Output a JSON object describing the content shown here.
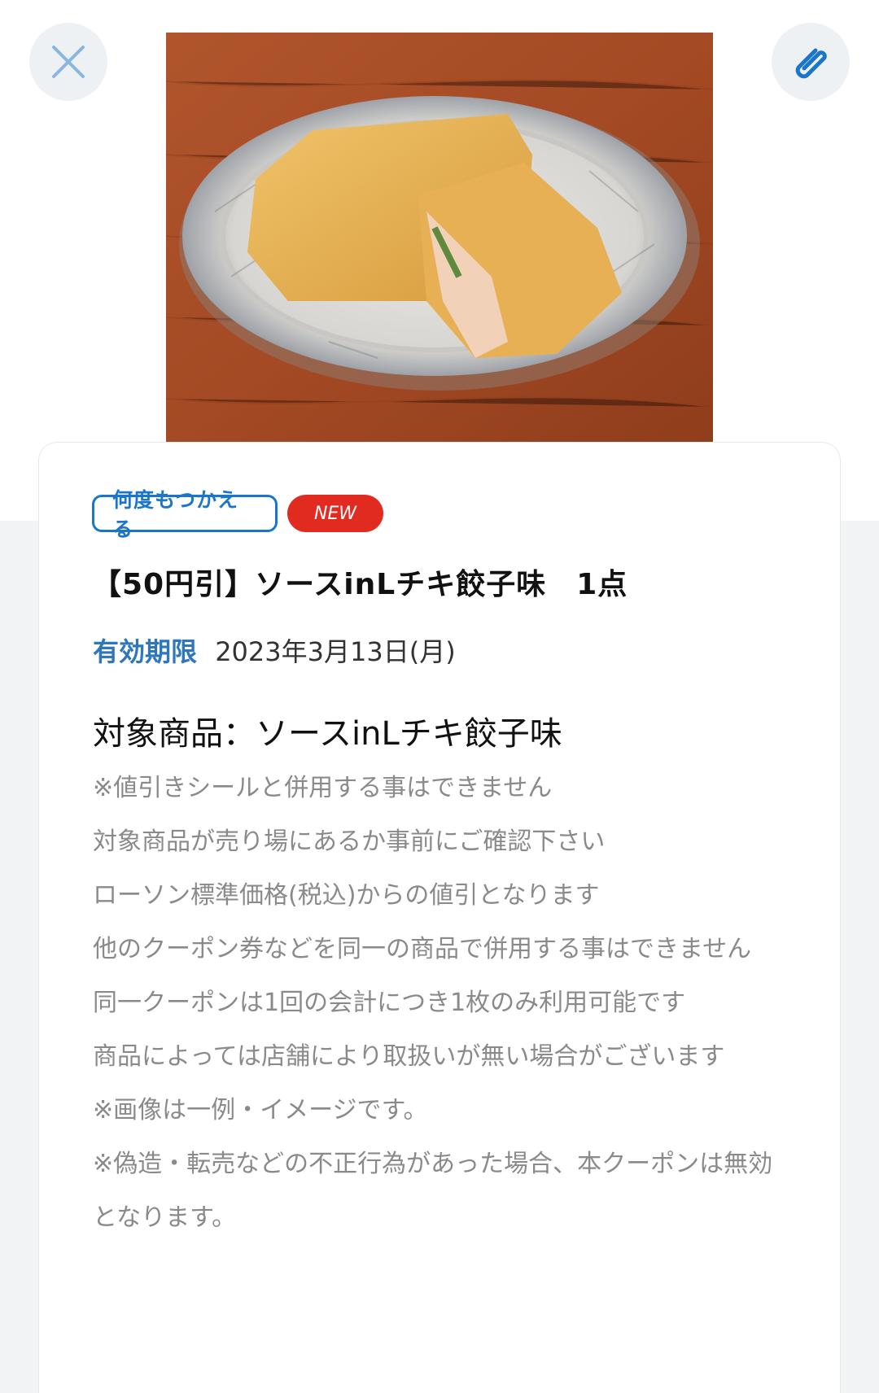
{
  "header": {
    "close_icon": "close-icon",
    "attach_icon": "paperclip-icon",
    "product_image": "product-photo"
  },
  "coupon": {
    "badge_reuse": "何度もつかえる",
    "badge_new": "NEW",
    "title": "【50円引】ソースinLチキ餃子味　1点",
    "validity_label": "有効期限",
    "validity_date": "2023年3月13日(月)",
    "target": "対象商品：ソースinLチキ餃子味",
    "notes": [
      "※値引きシールと併用する事はできません",
      "対象商品が売り場にあるか事前にご確認下さい",
      "ローソン標準価格(税込)からの値引となります",
      "他のクーポン券などを同一の商品で併用する事はできません",
      "同一クーポンは1回の会計につき1枚のみ利用可能です",
      "商品によっては店舗により取扱いが無い場合がございます",
      "※画像は一例・イメージです。",
      "※偽造・転売などの不正行為があった場合、本クーポンは無効となります。"
    ]
  },
  "colors": {
    "accent_blue": "#1b76c9",
    "new_red": "#e12a20",
    "label_blue": "#2f77bd",
    "note_gray": "#8a8a8a"
  }
}
